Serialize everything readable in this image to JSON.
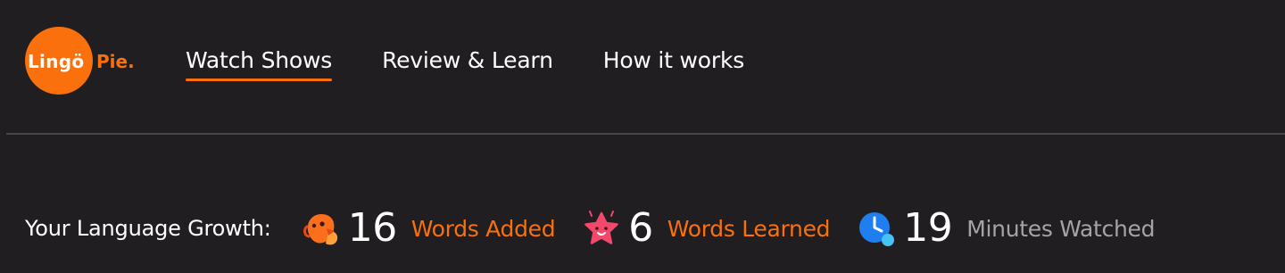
{
  "brand": {
    "logo_text_a": "Lingö",
    "logo_text_b": "Pie.",
    "accent_color": "#fa700d"
  },
  "nav": {
    "items": [
      {
        "label": "Watch Shows",
        "active": true
      },
      {
        "label": "Review & Learn",
        "active": false
      },
      {
        "label": "How it works",
        "active": false
      }
    ]
  },
  "growth": {
    "label": "Your Language Growth:",
    "stats": [
      {
        "icon": "bird-icon",
        "value": "16",
        "label": "Words Added",
        "label_color": "#fa700d"
      },
      {
        "icon": "star-icon",
        "value": "6",
        "label": "Words Learned",
        "label_color": "#fa700d"
      },
      {
        "icon": "clock-icon",
        "value": "19",
        "label": "Minutes Watched",
        "label_color": "#a6a2a5"
      }
    ]
  }
}
